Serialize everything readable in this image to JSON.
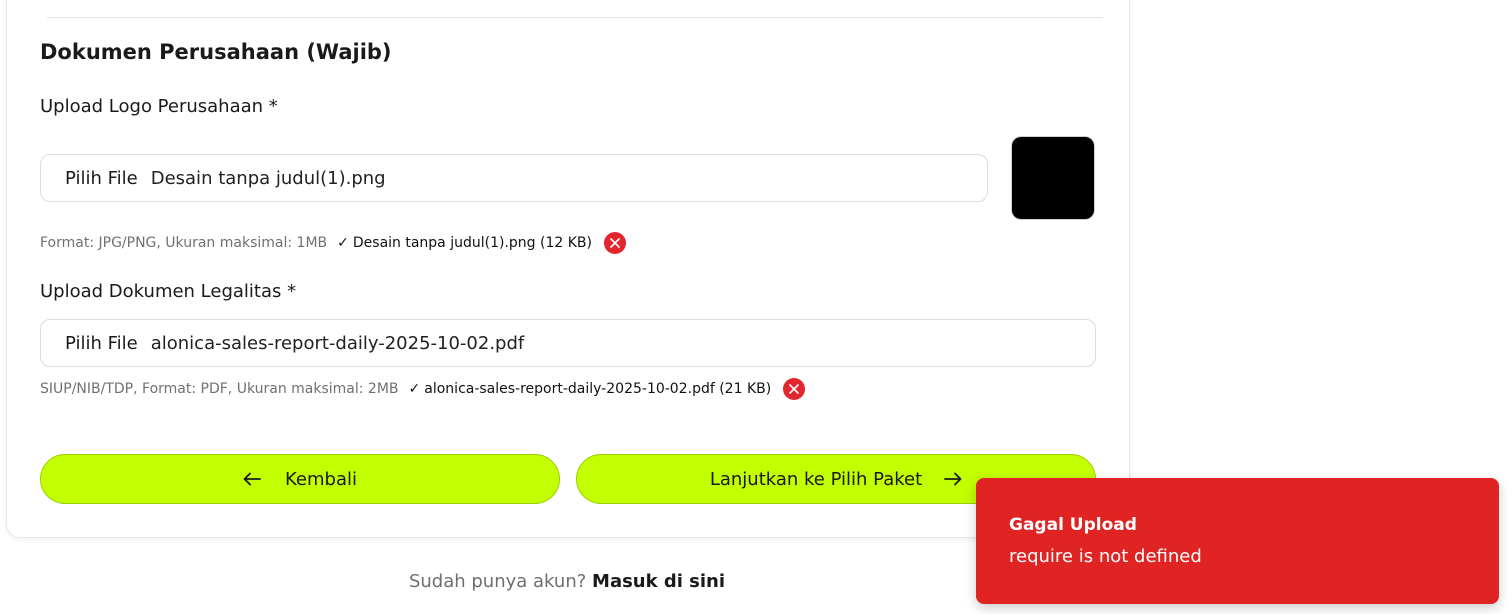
{
  "section": {
    "title": "Dokumen Perusahaan (Wajib)"
  },
  "logo_field": {
    "label": "Upload Logo Perusahaan *",
    "button_label": "Pilih File",
    "file_name": "Desain tanpa judul(1).png",
    "hint": "Format: JPG/PNG, Ukuran maksimal: 1MB",
    "check": "✓",
    "uploaded": "Desain tanpa judul(1).png (12 KB)"
  },
  "legal_field": {
    "label": "Upload Dokumen Legalitas *",
    "button_label": "Pilih File",
    "file_name": "alonica-sales-report-daily-2025-10-02.pdf",
    "hint": "SIUP/NIB/TDP, Format: PDF, Ukuran maksimal: 2MB",
    "check": "✓",
    "uploaded": "alonica-sales-report-daily-2025-10-02.pdf (21 KB)"
  },
  "actions": {
    "back_label": "Kembali",
    "next_label": "Lanjutkan ke Pilih Paket"
  },
  "login": {
    "prompt": "Sudah punya akun?",
    "link": "Masuk di sini"
  },
  "toast": {
    "title": "Gagal Upload",
    "message": "require is not defined"
  },
  "colors": {
    "accent_button": "#c2ff00",
    "error": "#e02424",
    "remove_icon": "#e3262e"
  },
  "icons": {
    "back": "arrow-left-icon",
    "next": "arrow-right-icon",
    "remove": "close-circle-icon"
  }
}
